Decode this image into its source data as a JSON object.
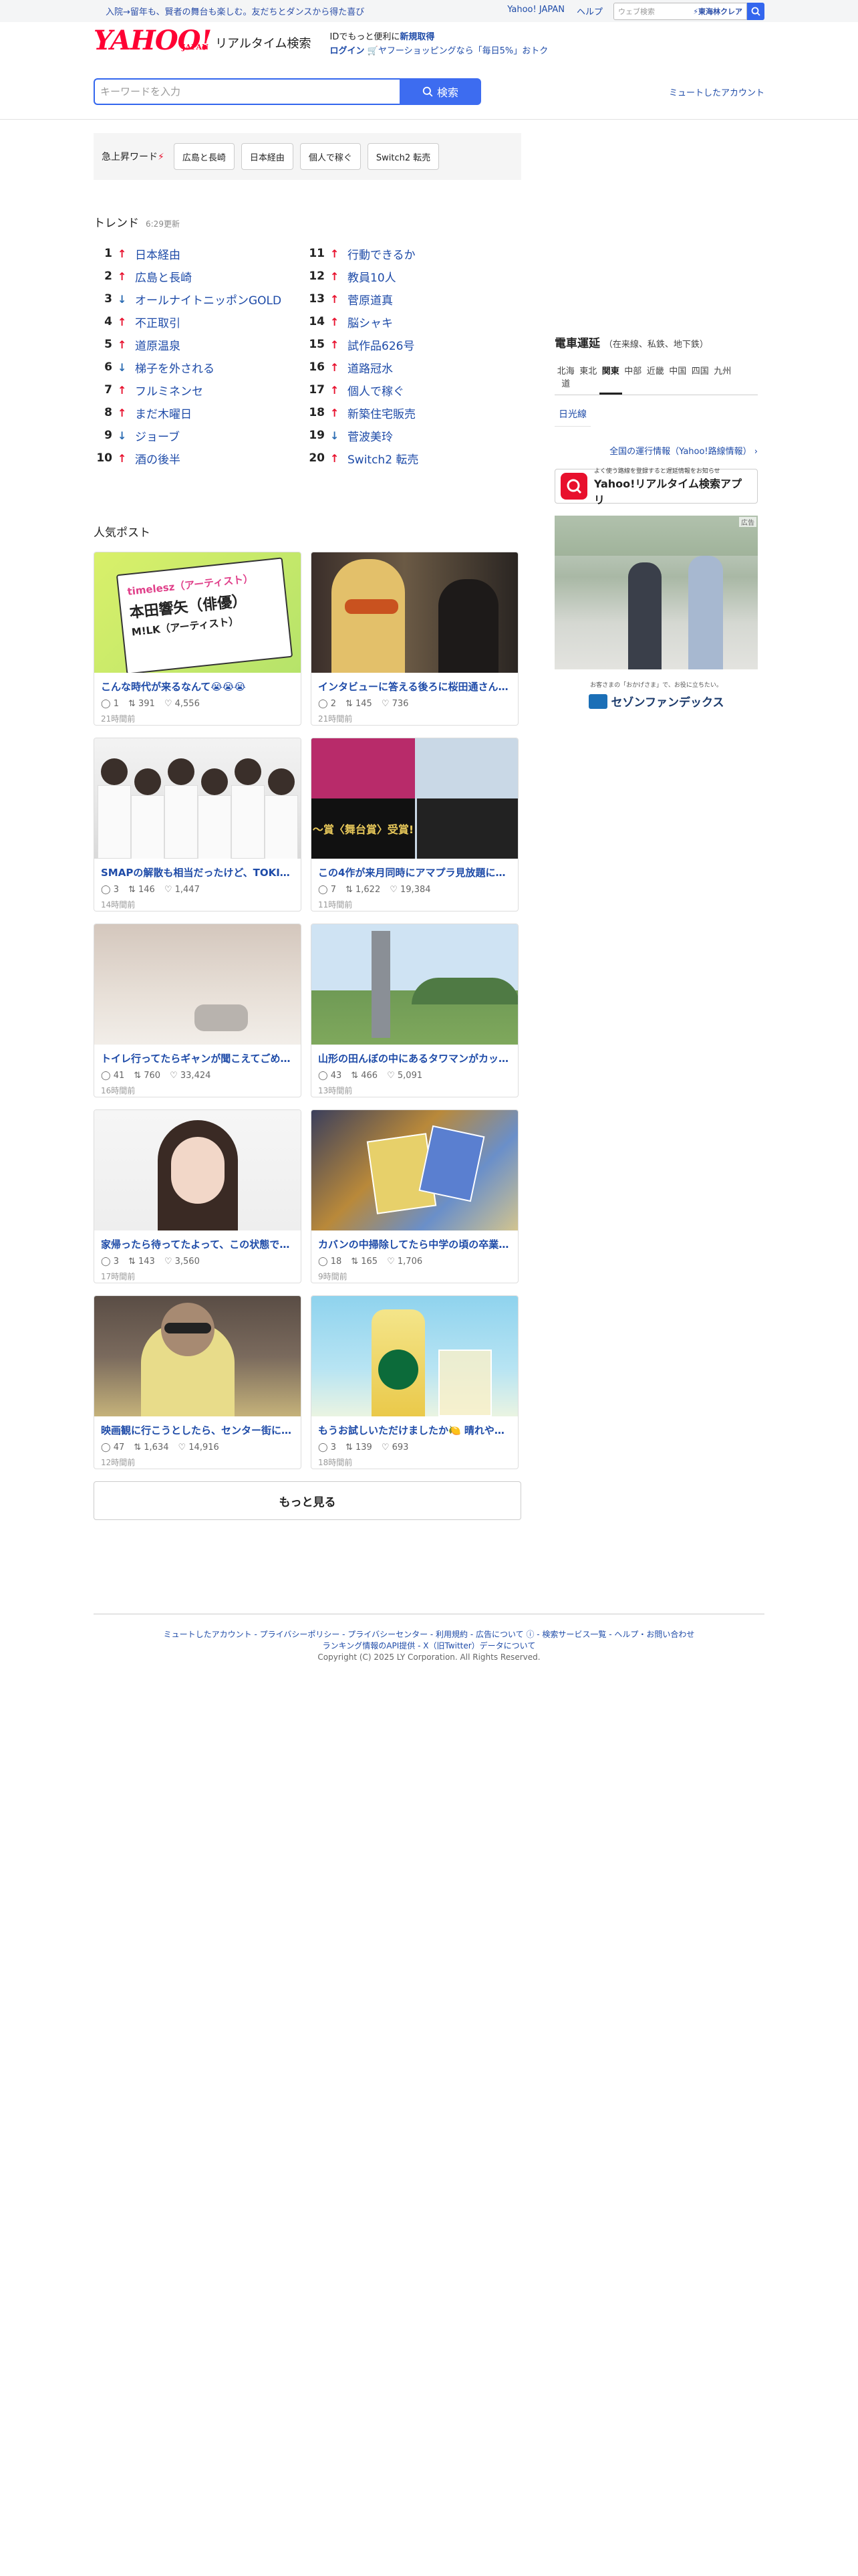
{
  "masthead": {
    "promo": "入院→留年も、賢者の舞台も楽しむ。友だちとダンスから得た喜び",
    "links": [
      "Yahoo! JAPAN",
      "ヘルプ"
    ],
    "search_placeholder": "ウェブ検索",
    "filter_label": "東海林クレア"
  },
  "header": {
    "logo_text": "YAHOO!",
    "logo_sub": "JAPAN",
    "service_name": "リアルタイム検索",
    "id_prompt": "IDでもっと便利に",
    "signup": "新規取得",
    "login": "ログイン",
    "shop_promo": "ヤフーショッピングなら「毎日5%」おトク"
  },
  "search": {
    "placeholder": "キーワードを入力",
    "button_label": "検索",
    "muted_accounts": "ミュートしたアカウント"
  },
  "rising": {
    "label": "急上昇ワード",
    "chips": [
      "広島と長崎",
      "日本経由",
      "個人で稼ぐ",
      "Switch2 転売"
    ]
  },
  "trend": {
    "title": "トレンド",
    "updated": "6:29更新",
    "left": [
      {
        "rank": "1",
        "dir": "up",
        "text": "日本経由"
      },
      {
        "rank": "2",
        "dir": "up",
        "text": "広島と長崎"
      },
      {
        "rank": "3",
        "dir": "down",
        "text": "オールナイトニッポンGOLD"
      },
      {
        "rank": "4",
        "dir": "up",
        "text": "不正取引"
      },
      {
        "rank": "5",
        "dir": "up",
        "text": "道原温泉"
      },
      {
        "rank": "6",
        "dir": "down",
        "text": "梯子を外される"
      },
      {
        "rank": "7",
        "dir": "up",
        "text": "フルミネンセ"
      },
      {
        "rank": "8",
        "dir": "up",
        "text": "まだ木曜日"
      },
      {
        "rank": "9",
        "dir": "down",
        "text": "ジョーブ"
      },
      {
        "rank": "10",
        "dir": "up",
        "text": "酒の後半"
      }
    ],
    "right": [
      {
        "rank": "11",
        "dir": "up",
        "text": "行動できるか"
      },
      {
        "rank": "12",
        "dir": "up",
        "text": "教員10人"
      },
      {
        "rank": "13",
        "dir": "up",
        "text": "菅原道真"
      },
      {
        "rank": "14",
        "dir": "up",
        "text": "脳シャキ"
      },
      {
        "rank": "15",
        "dir": "up",
        "text": "試作品626号"
      },
      {
        "rank": "16",
        "dir": "up",
        "text": "道路冠水"
      },
      {
        "rank": "17",
        "dir": "up",
        "text": "個人で稼ぐ"
      },
      {
        "rank": "18",
        "dir": "up",
        "text": "新築住宅販売"
      },
      {
        "rank": "19",
        "dir": "down",
        "text": "菅波美玲"
      },
      {
        "rank": "20",
        "dir": "up",
        "text": "Switch2 転売"
      }
    ]
  },
  "popular": {
    "title": "人気ポスト",
    "more_label": "もっと見る",
    "posts": [
      {
        "title": "こんな時代が来るなんて😭😭😭",
        "replies": "1",
        "reposts": "391",
        "likes": "4,556",
        "time": "21時間前",
        "img": "timelesz",
        "img_text": [
          "timelesz（アーティスト）",
          "本田響矢（俳優）",
          "M!LK（アーティスト）"
        ]
      },
      {
        "title": "インタビューに答える後ろに桜田通さんと…",
        "replies": "2",
        "reposts": "145",
        "likes": "736",
        "time": "21時間前",
        "img": "portrait-blond",
        "img_text": []
      },
      {
        "title": "SMAPの解散も相当だったけど、TOKIO…",
        "replies": "3",
        "reposts": "146",
        "likes": "1,447",
        "time": "14時間前",
        "img": "group-white",
        "img_text": []
      },
      {
        "title": "この4作が来月同時にアマプラ見放題に来る…",
        "replies": "7",
        "reposts": "1,622",
        "likes": "19,384",
        "time": "11時間前",
        "img": "collage",
        "img_text": [
          "〜賞〈舞台賞〉受賞!"
        ]
      },
      {
        "title": "トイレ行ってたらギャンが聞こえてごめん…",
        "replies": "41",
        "reposts": "760",
        "likes": "33,424",
        "time": "16時間前",
        "img": "bed",
        "img_text": []
      },
      {
        "title": "山形の田んぼの中にあるタワマンがカッコ…",
        "replies": "43",
        "reposts": "466",
        "likes": "5,091",
        "time": "13時間前",
        "img": "tower",
        "img_text": []
      },
      {
        "title": "家帰ったら待ってたよって、この状態で出…",
        "replies": "3",
        "reposts": "143",
        "likes": "3,560",
        "time": "17時間前",
        "img": "woman",
        "img_text": []
      },
      {
        "title": "カバンの中掃除してたら中学の頃の卒業式…",
        "replies": "18",
        "reposts": "165",
        "likes": "1,706",
        "time": "9時間前",
        "img": "cards",
        "img_text": []
      },
      {
        "title": "映画観に行こうとしたら、センター街にブ…",
        "replies": "47",
        "reposts": "1,634",
        "likes": "14,916",
        "time": "12時間前",
        "img": "street",
        "img_text": []
      },
      {
        "title": "もうお試しいただけましたか🍋 晴れやかな…",
        "replies": "3",
        "reposts": "139",
        "likes": "693",
        "time": "18時間前",
        "img": "starbucks",
        "img_text": []
      }
    ]
  },
  "transit": {
    "title": "電車運延",
    "subtitle": "（在来線、私鉄、地下鉄）",
    "regions": [
      "北海道",
      "東北",
      "関東",
      "中部",
      "近畿",
      "中国",
      "四国",
      "九州"
    ],
    "active_region": "関東",
    "line": "日光線",
    "nation_link": "全国の運行情報（Yahoo!路線情報）",
    "nation_arrow": "›"
  },
  "app_banner": {
    "subtitle": "よく使う路線を登録すると遅延情報をお知らせ",
    "title": "Yahoo!リアルタイム検索アプリ"
  },
  "ad": {
    "tag": "広告",
    "copy": "お客さまの「おかげさま」で、お役に立ちたい。",
    "brand": "セゾンファンデックス"
  },
  "footer": {
    "line1": "ミュートしたアカウント - プライバシーポリシー - プライバシーセンター - 利用規約 - 広告について ⓘ - 検索サービス一覧 - ヘルプ・お問い合わせ",
    "line2": "ランキング情報のAPI提供 - X（旧Twitter）データについて",
    "copyright": "Copyright (C) 2025 LY Corporation. All Rights Reserved."
  },
  "colors": {
    "accent": "#3d6cf0",
    "link": "#1e4ba8",
    "up": "#e8102d",
    "down": "#2b6cb3",
    "logo": "#ff0033"
  }
}
